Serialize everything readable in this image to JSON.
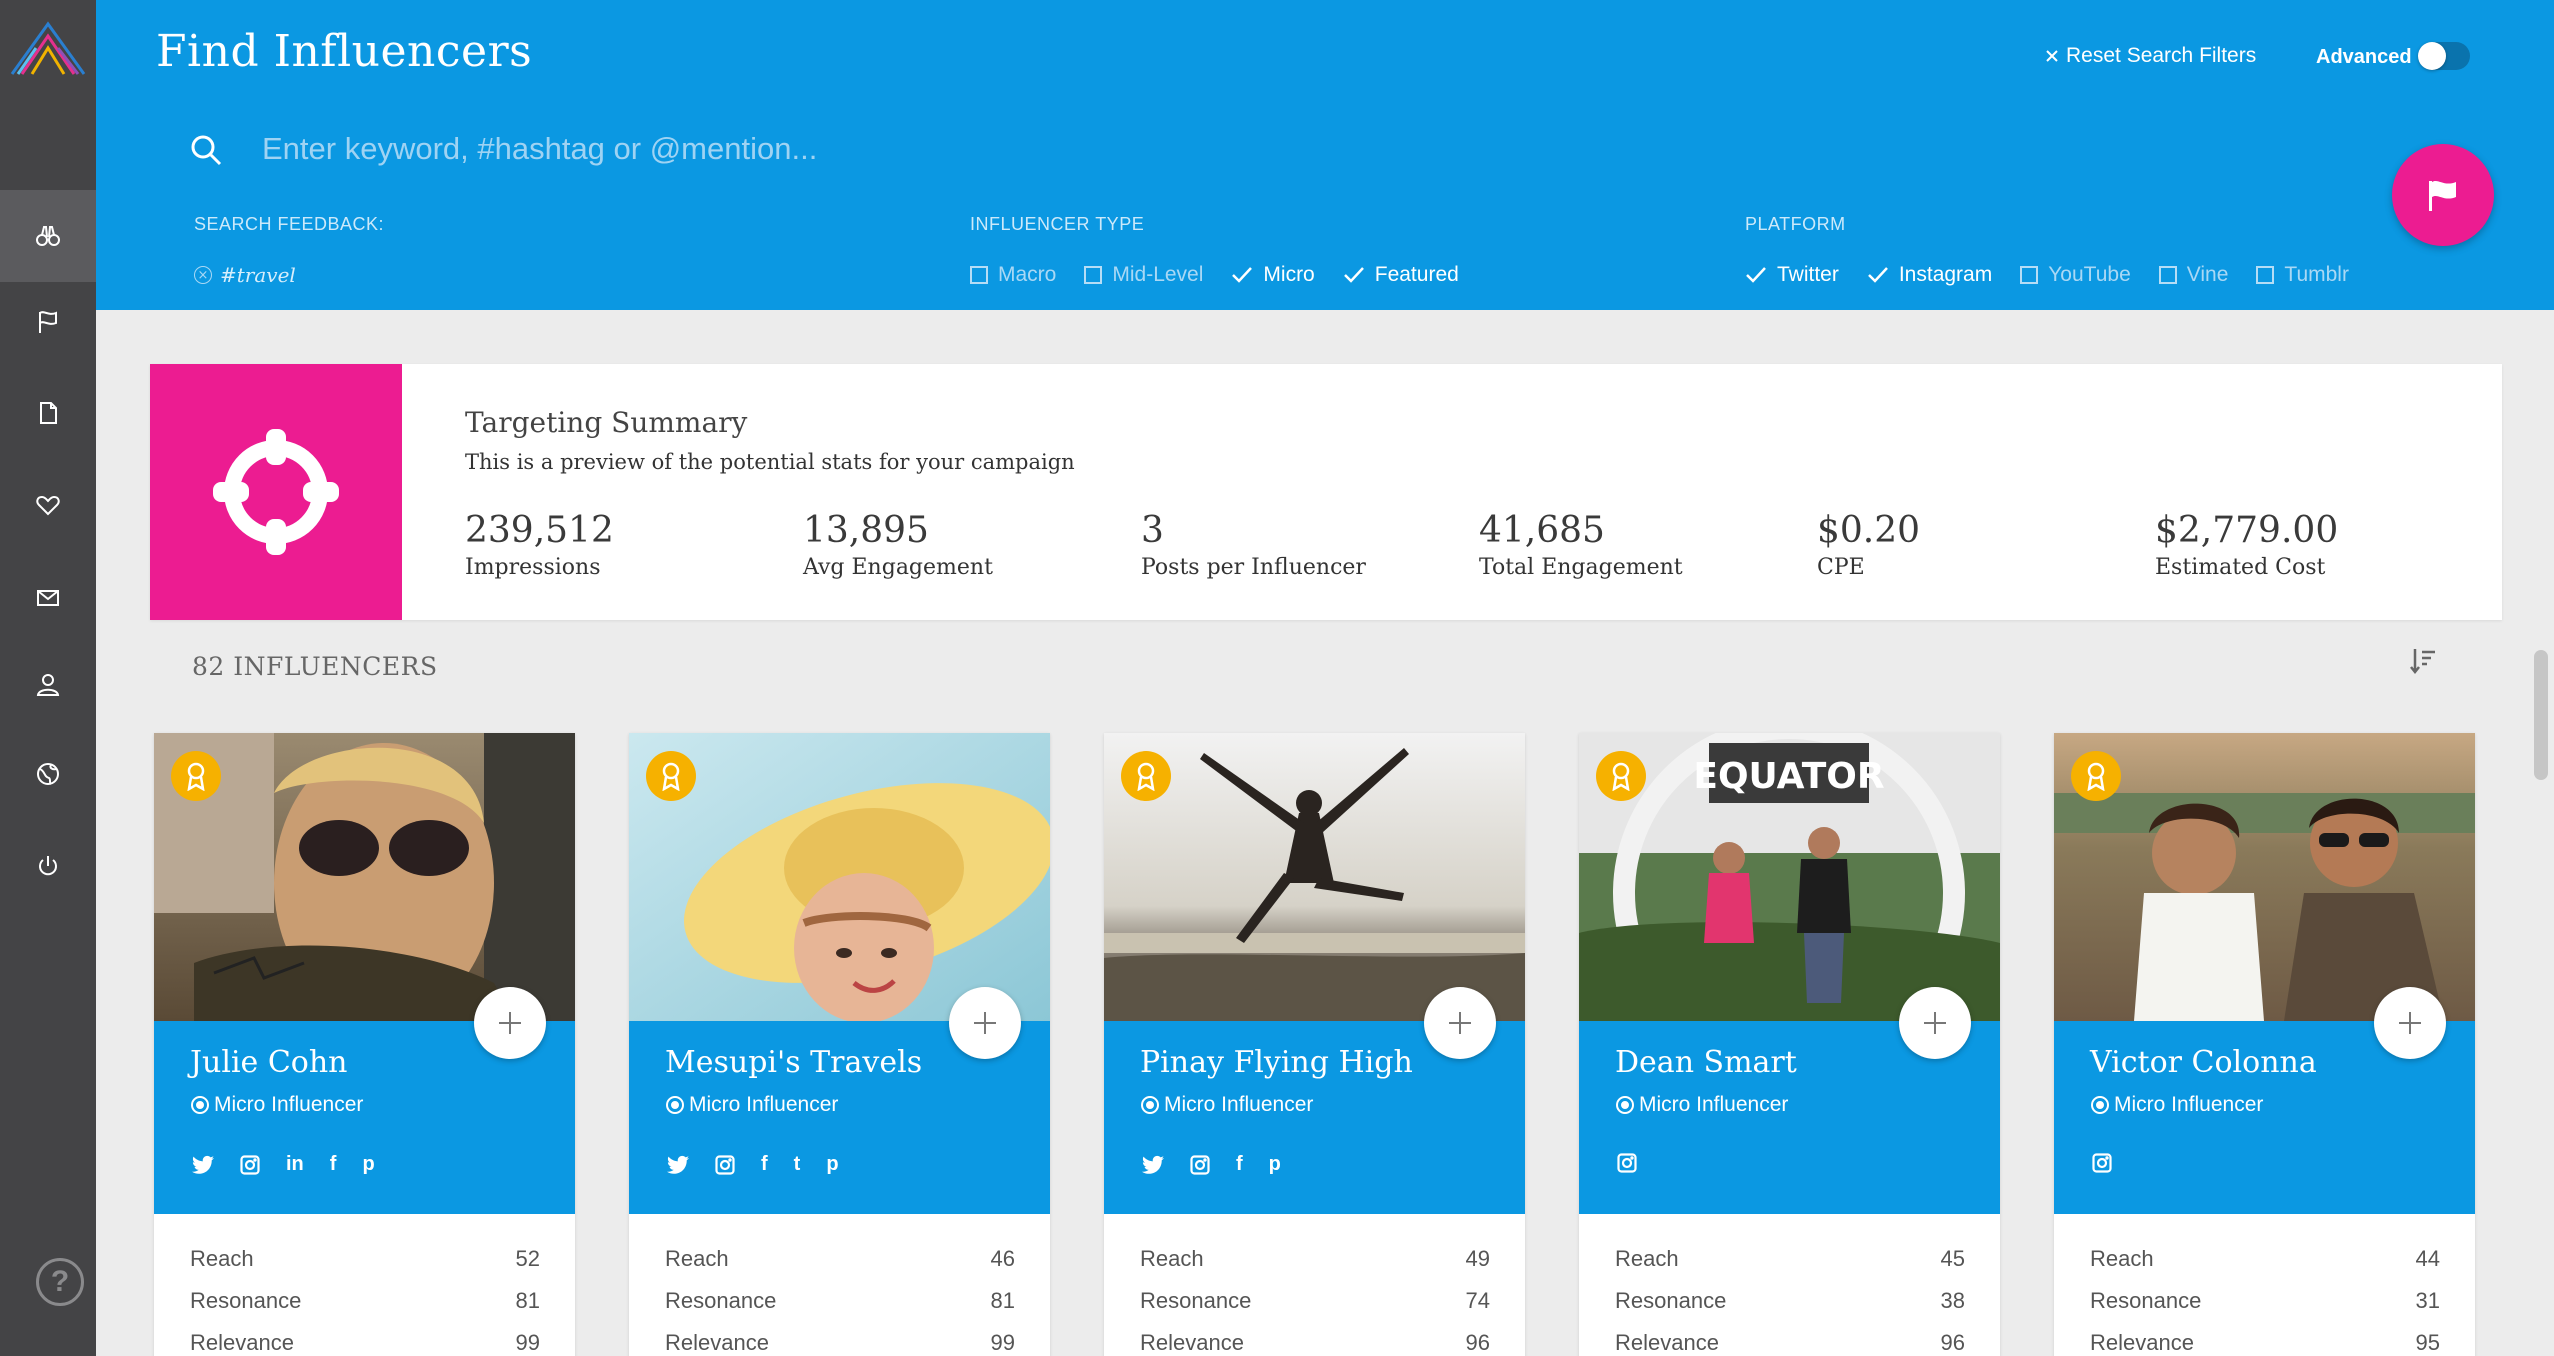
{
  "header": {
    "title": "Find Influencers",
    "reset_label": "Reset Search Filters",
    "advanced_label": "Advanced",
    "search_placeholder": "Enter keyword, #hashtag or @mention..."
  },
  "filters": {
    "feedback": {
      "title": "SEARCH FEEDBACK:",
      "tag": "#travel"
    },
    "influencer_type": {
      "title": "INFLUENCER TYPE",
      "options": [
        {
          "label": "Macro",
          "checked": false
        },
        {
          "label": "Mid-Level",
          "checked": false
        },
        {
          "label": "Micro",
          "checked": true
        },
        {
          "label": "Featured",
          "checked": true
        }
      ]
    },
    "platform": {
      "title": "PLATFORM",
      "options": [
        {
          "label": "Twitter",
          "checked": true
        },
        {
          "label": "Instagram",
          "checked": true
        },
        {
          "label": "YouTube",
          "checked": false
        },
        {
          "label": "Vine",
          "checked": false
        },
        {
          "label": "Tumblr",
          "checked": false
        }
      ]
    }
  },
  "summary": {
    "title": "Targeting Summary",
    "subtitle": "This is a preview of the potential stats for your campaign",
    "stats": [
      {
        "value": "239,512",
        "label": "Impressions"
      },
      {
        "value": "13,895",
        "label": "Avg Engagement"
      },
      {
        "value": "3",
        "label": "Posts per Influencer"
      },
      {
        "value": "41,685",
        "label": "Total Engagement"
      },
      {
        "value": "$0.20",
        "label": "CPE"
      },
      {
        "value": "$2,779.00",
        "label": "Estimated Cost"
      }
    ]
  },
  "results": {
    "count_label": "82 INFLUENCERS",
    "metric_labels": [
      "Reach",
      "Resonance",
      "Relevance"
    ],
    "cards": [
      {
        "name": "Julie Cohn",
        "type": "Micro Influencer",
        "socials": [
          "twitter-icon",
          "instagram-icon",
          "linkedin-icon",
          "facebook-icon",
          "pinterest-icon"
        ],
        "reach": "52",
        "resonance": "81",
        "relevance": "99"
      },
      {
        "name": "Mesupi's Travels",
        "type": "Micro Influencer",
        "socials": [
          "twitter-icon",
          "instagram-icon",
          "facebook-icon",
          "tumblr-icon",
          "pinterest-icon"
        ],
        "reach": "46",
        "resonance": "81",
        "relevance": "99"
      },
      {
        "name": "Pinay Flying High",
        "type": "Micro Influencer",
        "socials": [
          "twitter-icon",
          "instagram-icon",
          "facebook-icon",
          "pinterest-icon"
        ],
        "reach": "49",
        "resonance": "74",
        "relevance": "96"
      },
      {
        "name": "Dean Smart",
        "type": "Micro Influencer",
        "socials": [
          "instagram-icon"
        ],
        "reach": "45",
        "resonance": "38",
        "relevance": "96"
      },
      {
        "name": "Victor Colonna",
        "type": "Micro Influencer",
        "socials": [
          "instagram-icon"
        ],
        "reach": "44",
        "resonance": "31",
        "relevance": "95"
      }
    ]
  },
  "colors": {
    "brand_blue": "#0b98e2",
    "accent_pink": "#ec1c91",
    "badge_gold": "#f6b100",
    "sidebar": "#444446"
  }
}
